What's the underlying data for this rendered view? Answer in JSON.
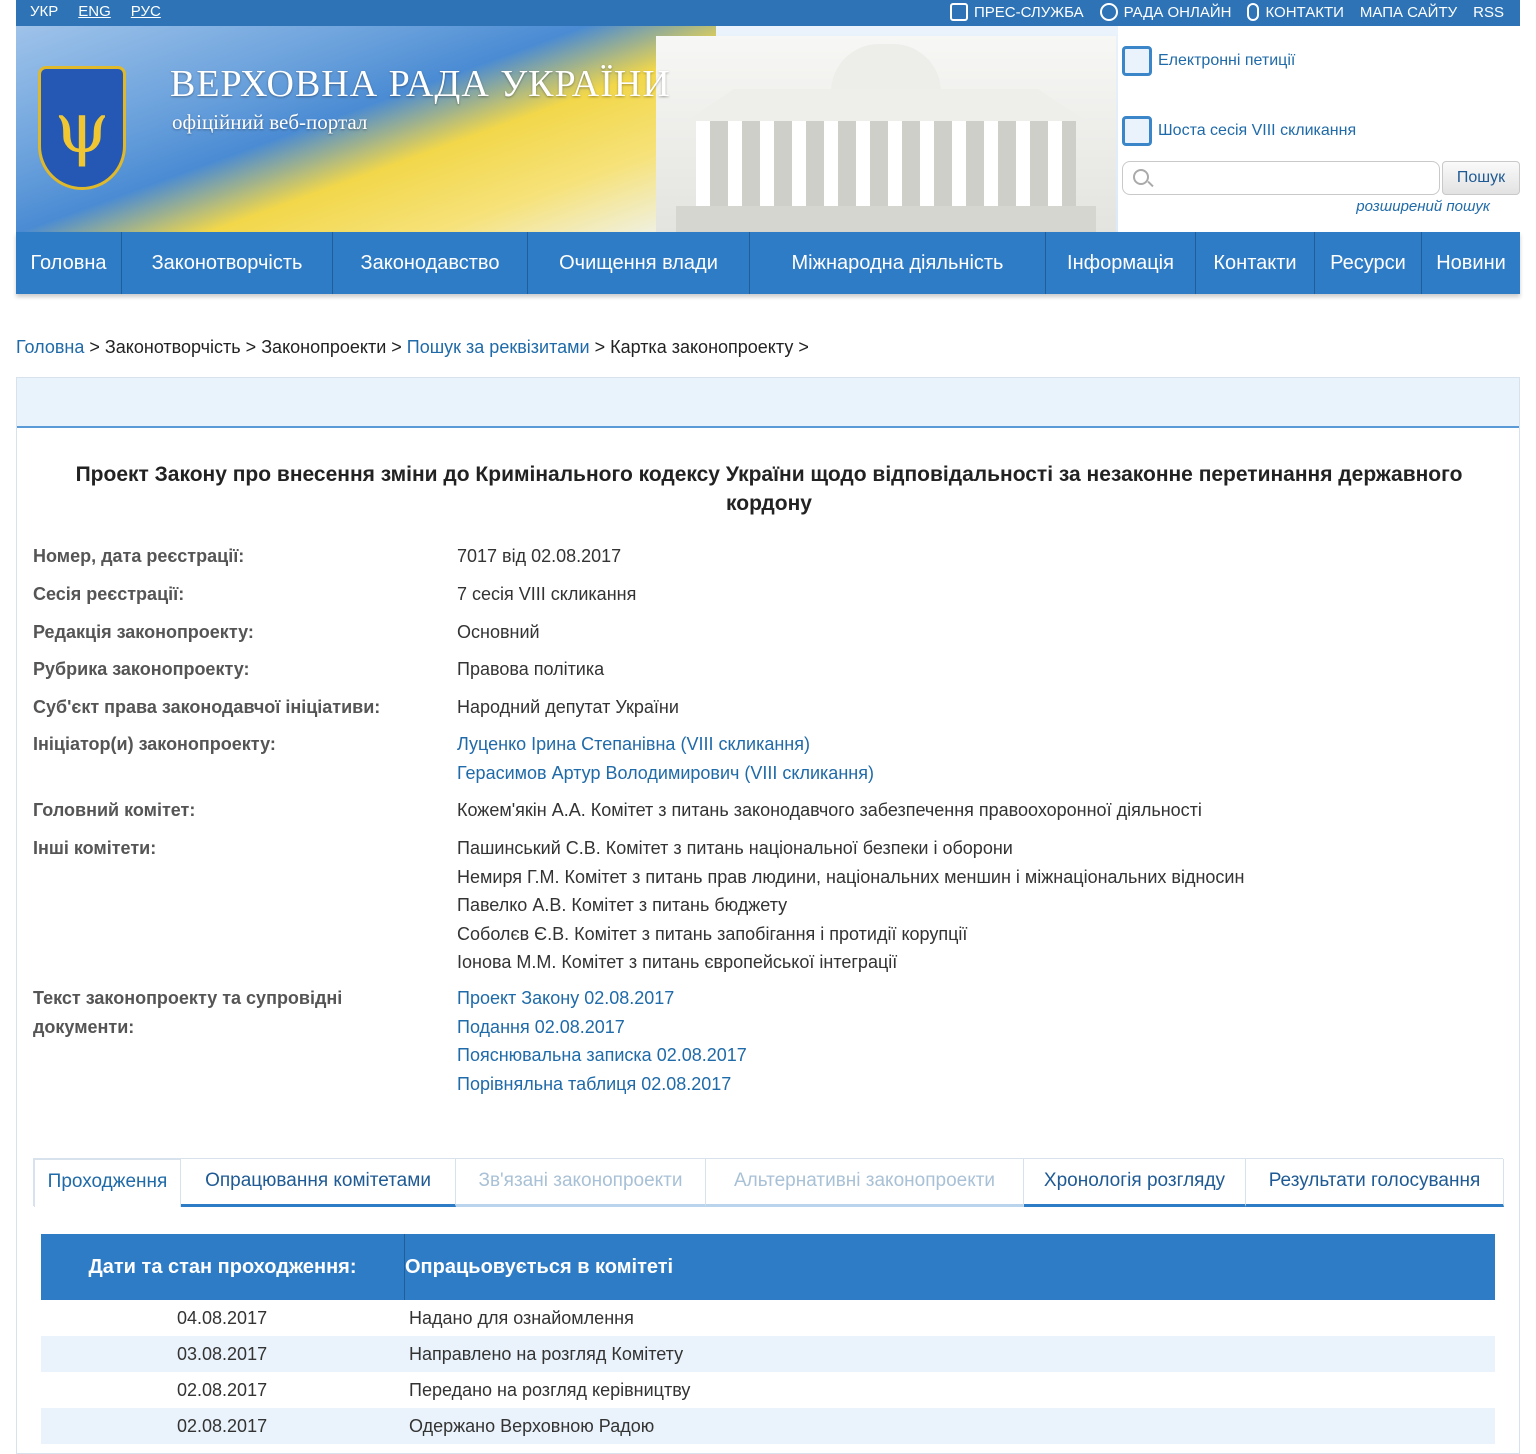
{
  "topbar": {
    "langs": [
      "УКР",
      "ENG",
      "РУС"
    ],
    "links": [
      "ПРЕС-СЛУЖБА",
      "РАДА ОНЛАЙН",
      "КОНТАКТИ",
      "МАПА САЙТУ",
      "RSS"
    ]
  },
  "header": {
    "title": "ВЕРХОВНА РАДА УКРАЇНИ",
    "subtitle": "офіційний веб-портал",
    "petitions": "Електронні петиції",
    "session": "Шоста сесія VIII скликання",
    "search_button": "Пошук",
    "search_placeholder": "",
    "advanced_search": "розширений пошук"
  },
  "nav": [
    "Головна",
    "Законотворчість",
    "Законодавство",
    "Очищення влади",
    "Міжнародна діяльність",
    "Інформація",
    "Контакти",
    "Ресурси",
    "Новини"
  ],
  "breadcrumb": {
    "home": "Головна",
    "sep": " > ",
    "lawmaking": "Законотворчість",
    "bills": "Законопроекти",
    "search": "Пошук за реквізитами",
    "card": "Картка законопроекту",
    "tail": " >"
  },
  "bill": {
    "title": "Проект Закону про внесення зміни до Кримінального кодексу України щодо відповідальності за незаконне перетинання державного кордону",
    "fields": {
      "number_label": "Номер, дата реєстрації:",
      "number_value": "7017 від 02.08.2017",
      "session_label": "Сесія реєстрації:",
      "session_value": "7 сесія VIII скликання",
      "edition_label": "Редакція законопроекту:",
      "edition_value": "Основний",
      "rubric_label": "Рубрика законопроекту:",
      "rubric_value": "Правова політика",
      "subject_label": "Суб'єкт права законодавчої ініціативи:",
      "subject_value": "Народний депутат України",
      "initiators_label": "Ініціатор(и) законопроекту:",
      "initiators": [
        "Луценко Ірина Степанівна (VIII скликання)",
        "Герасимов Артур Володимирович (VIII скликання)"
      ],
      "main_committee_label": "Головний комітет:",
      "main_committee_value": "Кожем'якін А.А. Комітет з питань законодавчого забезпечення правоохоронної діяльності",
      "other_committees_label": "Інші комітети:",
      "other_committees": [
        "Пашинський С.В. Комітет з питань національної безпеки і оборони",
        "Немиря Г.М. Комітет з питань прав людини, національних меншин і міжнаціональних відносин",
        "Павелко А.В. Комітет з питань бюджету",
        "Соболєв Є.В. Комітет з питань запобігання і протидії корупції",
        "Іонова М.М. Комітет з питань європейської інтеграції"
      ],
      "docs_label_1": "Текст законопроекту та супровідні",
      "docs_label_2": "документи:",
      "docs": [
        "Проект Закону 02.08.2017",
        "Подання 02.08.2017",
        "Пояснювальна записка 02.08.2017",
        "Порівняльна таблиця 02.08.2017"
      ]
    }
  },
  "tabs": [
    "Проходження",
    "Опрацювання комітетами",
    "Зв'язані законопроекти",
    "Альтернативні законопроекти",
    "Хронологія розгляду",
    "Результати голосування"
  ],
  "status": {
    "col1": "Дати та стан проходження:",
    "col2": "Опрацьовується в комітеті",
    "rows": [
      {
        "date": "04.08.2017",
        "text": "Надано для ознайомлення"
      },
      {
        "date": "03.08.2017",
        "text": "Направлено на розгляд Комітету"
      },
      {
        "date": "02.08.2017",
        "text": "Передано на розгляд керівництву"
      },
      {
        "date": "02.08.2017",
        "text": "Одержано Верховною Радою"
      }
    ]
  },
  "colors": {
    "nav": "#2f7cc6",
    "link": "#1f6aa8",
    "topbar": "#2d73b6"
  },
  "icons": [
    "press-icon",
    "broadcast-icon",
    "phone-icon",
    "petition-icon",
    "calendar-icon",
    "search-icon"
  ]
}
